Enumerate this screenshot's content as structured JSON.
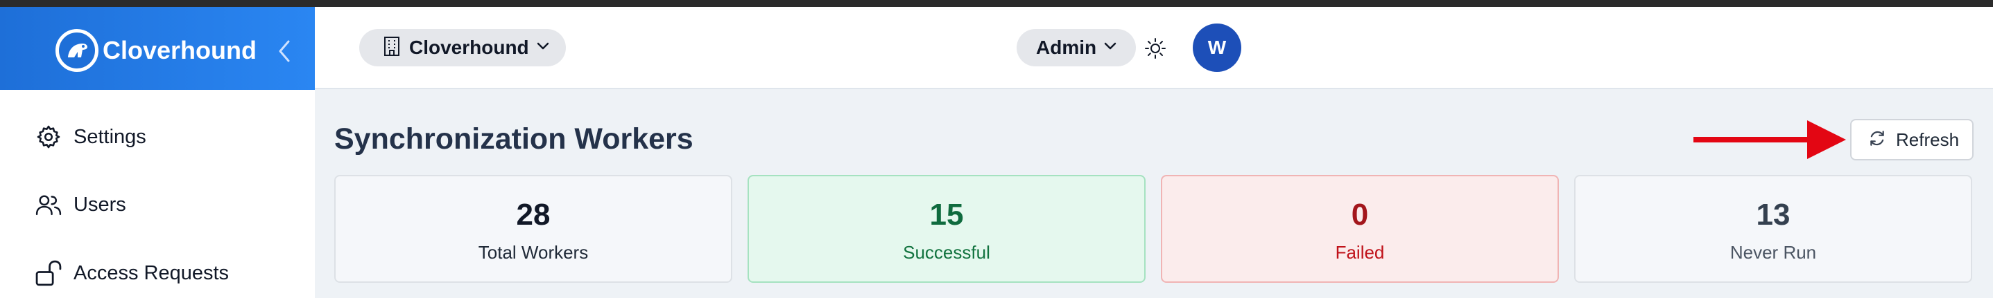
{
  "brand": {
    "name": "Cloverhound"
  },
  "sidebar": {
    "items": [
      {
        "label": "Settings",
        "icon": "gear-icon"
      },
      {
        "label": "Users",
        "icon": "users-icon"
      },
      {
        "label": "Access Requests",
        "icon": "unlock-icon"
      }
    ]
  },
  "header": {
    "org_selector": {
      "label": "Cloverhound",
      "icon": "building-icon"
    },
    "role_selector": {
      "label": "Admin"
    },
    "theme_toggle_icon": "sun-icon",
    "avatar_initial": "W"
  },
  "main": {
    "title": "Synchronization Workers",
    "refresh_label": "Refresh",
    "stats": [
      {
        "value": "28",
        "label": "Total Workers"
      },
      {
        "value": "15",
        "label": "Successful"
      },
      {
        "value": "0",
        "label": "Failed"
      },
      {
        "value": "13",
        "label": "Never Run"
      }
    ]
  },
  "colors": {
    "brand_gradient_start": "#1e6fd8",
    "brand_gradient_end": "#2a86f2",
    "success": "#0f6b3e",
    "failed": "#c0121a",
    "annotation_arrow": "#e30613"
  }
}
